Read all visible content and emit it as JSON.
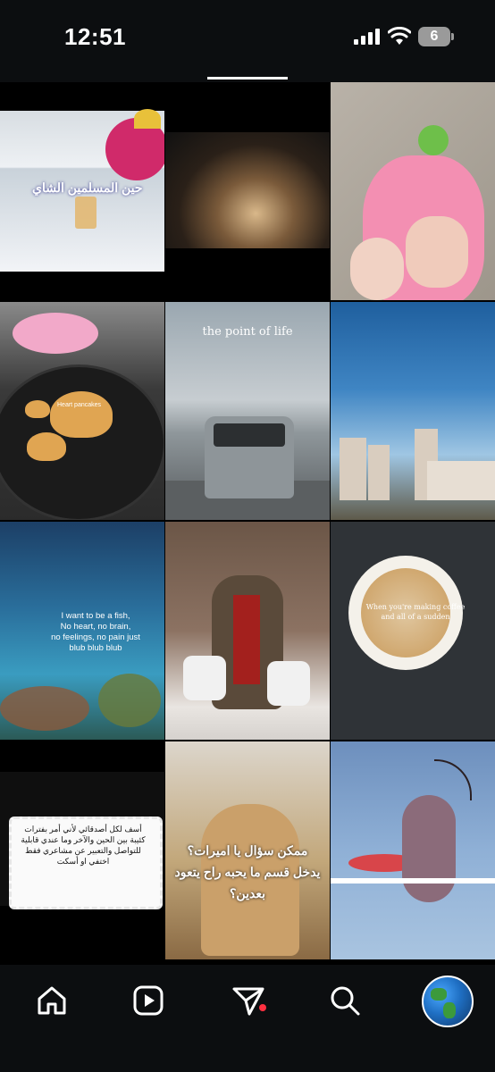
{
  "status_bar": {
    "time": "12:51",
    "battery_level": "6"
  },
  "grid": {
    "tiles": [
      {
        "caption": "حين المسلمين الشاي"
      },
      {
        "caption": ""
      },
      {
        "caption": ""
      },
      {
        "caption": "Heart pancakes"
      },
      {
        "caption": "the point of life"
      },
      {
        "caption": ""
      },
      {
        "caption": "I want to be a fish,\nNo heart, no brain,\nno feelings, no pain just\nblub blub blub"
      },
      {
        "caption": ""
      },
      {
        "caption": "When you're making coffee\nand all of a sudden"
      },
      {
        "caption": "أسف لكل أصدقائي لأني أمر بفترات\nكئيبة بين الحين والآخر وما عندي قابلية\nللتواصل والتعبير عن مشاعري فقط\nاختفي او أسكت"
      },
      {
        "caption": "ممكن سؤال يا اميرات؟\nيدخل قسم ما يحبه راح يتعود\nبعدين؟"
      },
      {
        "caption": ""
      }
    ]
  },
  "nav": {
    "items": [
      "home-icon",
      "reels-icon",
      "messages-icon",
      "search-icon",
      "profile-avatar"
    ],
    "notification_color": "#ff3040"
  }
}
